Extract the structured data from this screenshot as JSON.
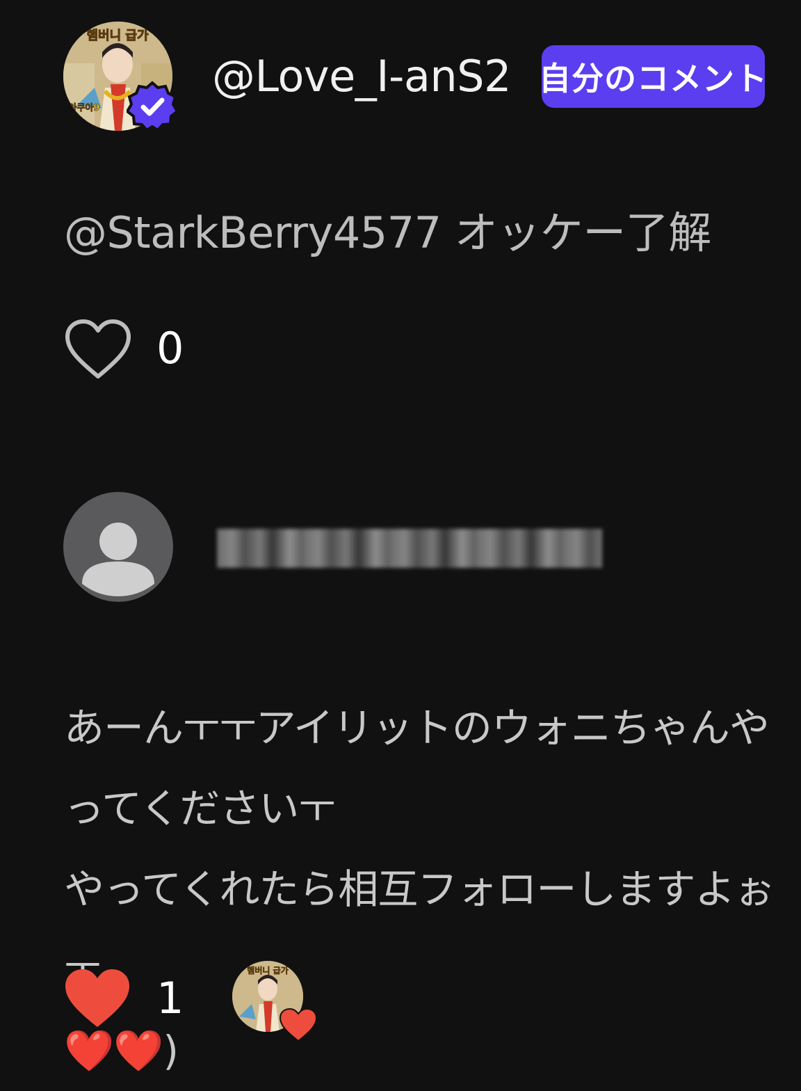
{
  "comments": [
    {
      "author": "@Love_I-anS2",
      "author_verified": true,
      "badge_label": "自分のコメント",
      "avatar_caption_top": "햄버니 급가",
      "avatar_caption_bottom": "아쿠아9",
      "text": "@StarkBerry4577 オッケー了解",
      "likes": "0",
      "liked": false
    },
    {
      "author_hidden": true,
      "avatar": "default-user-avatar",
      "text": "あーんㅜㅜアイリットのウォニちゃんやってくださいㅜ\nやってくれたら相互フォローしますよぉㅜ\n❤️❤️)",
      "likes": "1",
      "liked": true,
      "liked_by_creator": true
    }
  ],
  "colors": {
    "background": "#111111",
    "badge": "#5b3ef0",
    "like_active": "#ee4d3d",
    "text_primary": "#f0f0f0",
    "text_secondary": "#bdbdbd"
  }
}
